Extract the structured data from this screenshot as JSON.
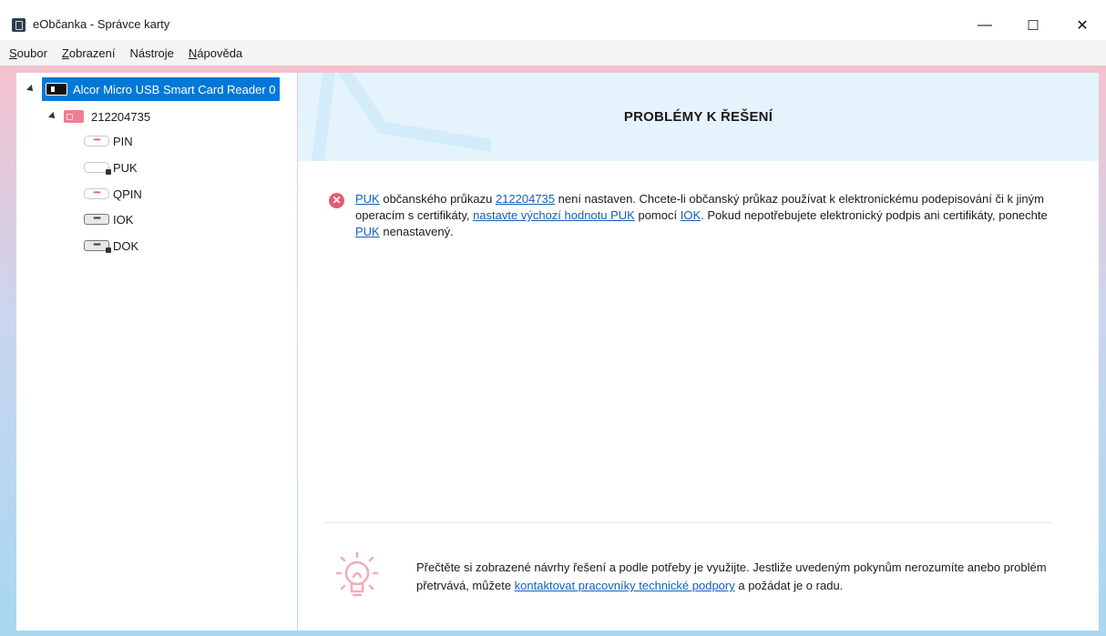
{
  "window": {
    "title": "eObčanka - Správce karty",
    "minimize": "—",
    "maximize": "☐",
    "close": "✕"
  },
  "menu": [
    {
      "label": "Soubor",
      "accel": "S",
      "rest": "oubor"
    },
    {
      "label": "Zobrazení",
      "accel": "Z",
      "rest": "obrazení"
    },
    {
      "label": "Nástroje",
      "accel": "",
      "rest": ""
    },
    {
      "label": "Nápověda",
      "accel": "N",
      "rest": "ápověda"
    }
  ],
  "tree": {
    "reader": "Alcor Micro USB Smart Card Reader 0",
    "card": "212204735",
    "items": [
      "PIN",
      "PUK",
      "QPIN",
      "IOK",
      "DOK"
    ]
  },
  "main": {
    "header_title": "PROBLÉMY K ŘEŠENÍ",
    "problem": {
      "link_puk": "PUK",
      "t1": " občanského průkazu ",
      "link_card": "212204735",
      "t2": " není nastaven. Chcete-li občanský průkaz používat k elektronickému podepisování či k jiným operacím s certifikáty, ",
      "link_set_default": "nastavte výchozí hodnotu PUK",
      "t3": " pomocí ",
      "link_iok": "IOK",
      "t4": ". Pokud nepotřebujete elektronický podpis ani certifikáty, ponechte ",
      "link_puk2": "PUK",
      "t5": " nenastavený."
    },
    "hint": {
      "t1": "Přečtěte si zobrazené návrhy řešení a podle potřeby je využijte. Jestliže uvedeným pokynům nerozumíte anebo problém přetrvává, můžete ",
      "link_support": "kontaktovat pracovníky technické podpory",
      "t2": " a požádat je o radu."
    }
  },
  "colors": {
    "selection": "#0078d7",
    "header_bg": "#e5f4fc",
    "error": "#e55a73",
    "link": "#1560b8",
    "bulb": "#f7a9b8"
  }
}
